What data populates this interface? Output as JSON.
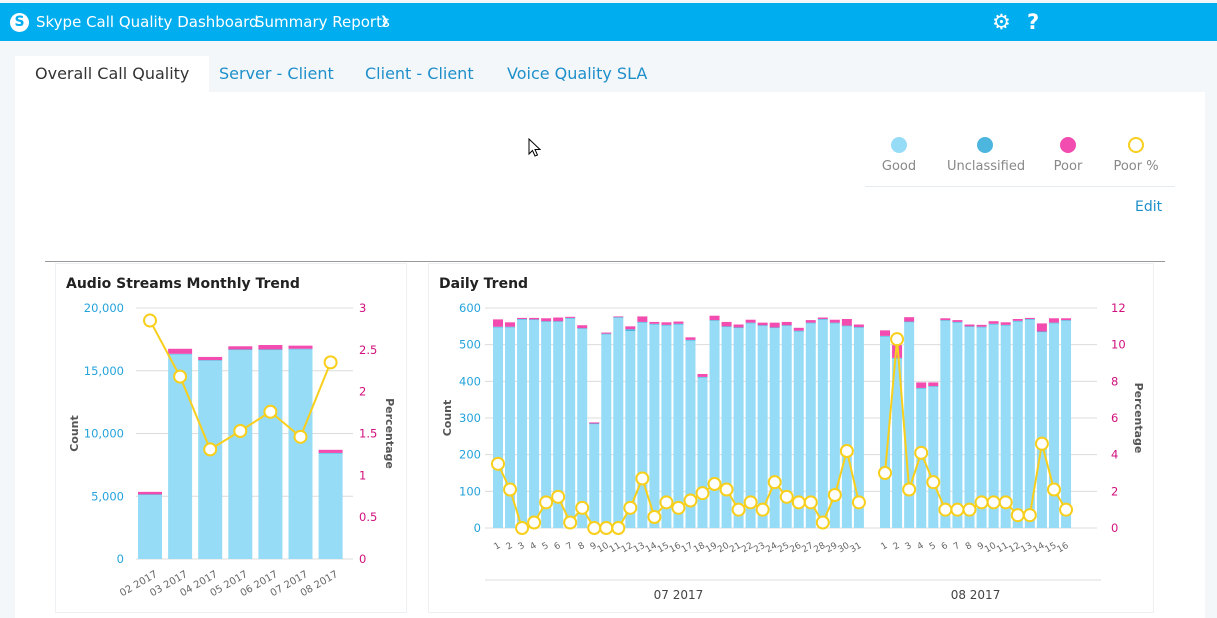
{
  "header": {
    "logo_letter": "S",
    "app_title": "Skype Call Quality Dashboard",
    "menu_label": "Summary Reports",
    "menu_chevron": "⌄",
    "settings_icon": "⚙",
    "help_icon": "?"
  },
  "tabs": [
    {
      "label": "Overall Call Quality",
      "active": true
    },
    {
      "label": "Server - Client",
      "active": false
    },
    {
      "label": "Client - Client",
      "active": false
    },
    {
      "label": "Voice Quality SLA",
      "active": false
    }
  ],
  "legend": [
    {
      "label": "Good",
      "color": "#96dcf6",
      "style": "filled"
    },
    {
      "label": "Unclassified",
      "color": "#4cb6de",
      "style": "filled"
    },
    {
      "label": "Poor",
      "color": "#f24cb0",
      "style": "filled"
    },
    {
      "label": "Poor %",
      "color": "#f8cf1c",
      "style": "ring"
    }
  ],
  "edit_label": "Edit",
  "colors": {
    "accent": "#00adef",
    "good": "#96dcf6",
    "unclassified": "#4cb6de",
    "poor": "#f24cb0",
    "poor_pct": "#f8cf1c",
    "left_axis": "#25a3dc",
    "right_axis": "#d1107e"
  },
  "chart_data": [
    {
      "type": "bar",
      "title": "Audio Streams Monthly Trend",
      "stacked": true,
      "categories": [
        "02 2017",
        "03 2017",
        "04 2017",
        "05 2017",
        "06 2017",
        "07 2017",
        "08 2017"
      ],
      "series": [
        {
          "name": "Good",
          "values": [
            5100,
            16300,
            15800,
            16650,
            16650,
            16700,
            8400
          ]
        },
        {
          "name": "Unclassified",
          "values": [
            50,
            50,
            50,
            50,
            50,
            50,
            50
          ]
        },
        {
          "name": "Poor",
          "values": [
            200,
            400,
            250,
            250,
            350,
            250,
            250
          ]
        },
        {
          "name": "Poor %",
          "type": "line",
          "axis": "right",
          "values": [
            2.85,
            2.18,
            1.31,
            1.53,
            1.76,
            1.46,
            2.35
          ]
        }
      ],
      "ylabel": "Count",
      "ylabel_right": "Percentage",
      "ylim": [
        0,
        20000
      ],
      "yticks": [
        "0",
        "5,000",
        "10,000",
        "15,000",
        "20,000"
      ],
      "ylim_right": [
        0,
        3
      ],
      "yticks_right": [
        "0",
        "0.5",
        "1",
        "1.5",
        "2",
        "2.5",
        "3"
      ],
      "grid": true
    },
    {
      "type": "bar",
      "title": "Daily Trend",
      "stacked": true,
      "groups": [
        {
          "label": "07 2017",
          "days": [
            "1",
            "2",
            "3",
            "4",
            "5",
            "6",
            "7",
            "8",
            "9",
            "10",
            "11",
            "12",
            "13",
            "14",
            "15",
            "16",
            "17",
            "18",
            "19",
            "20",
            "21",
            "22",
            "23",
            "24",
            "25",
            "26",
            "27",
            "28",
            "29",
            "30",
            "31"
          ]
        },
        {
          "label": "08 2017",
          "days": [
            "1",
            "2",
            "3",
            "4",
            "5",
            "6",
            "7",
            "8",
            "9",
            "10",
            "11",
            "12",
            "13",
            "14",
            "15",
            "16"
          ]
        }
      ],
      "series": [
        {
          "name": "Good",
          "values": [
            547,
            547,
            568,
            567,
            562,
            562,
            571,
            543,
            283,
            528,
            573,
            537,
            560,
            555,
            552,
            555,
            511,
            410,
            565,
            548,
            545,
            558,
            551,
            545,
            551,
            536,
            558,
            568,
            558,
            550,
            546,
            522,
            462,
            561,
            380,
            385,
            565,
            560,
            548,
            547,
            555,
            552,
            563,
            568,
            534,
            558,
            565
          ]
        },
        {
          "name": "Unclassified",
          "values": [
            2,
            2,
            2,
            2,
            2,
            2,
            2,
            2,
            2,
            2,
            2,
            5,
            2,
            2,
            2,
            2,
            2,
            2,
            2,
            2,
            2,
            2,
            2,
            2,
            2,
            2,
            2,
            2,
            2,
            2,
            2,
            2,
            2,
            2,
            2,
            2,
            2,
            2,
            2,
            2,
            2,
            2,
            2,
            2,
            2,
            2,
            2
          ]
        },
        {
          "name": "Poor",
          "values": [
            20,
            12,
            3,
            4,
            8,
            10,
            3,
            8,
            3,
            3,
            2,
            8,
            15,
            5,
            7,
            6,
            7,
            8,
            12,
            12,
            8,
            8,
            7,
            13,
            9,
            8,
            7,
            4,
            8,
            18,
            7,
            15,
            35,
            12,
            15,
            10,
            5,
            5,
            5,
            5,
            7,
            7,
            5,
            3,
            22,
            12,
            5
          ]
        },
        {
          "name": "Poor %",
          "type": "line",
          "axis": "right",
          "values": [
            3.5,
            2.1,
            0,
            0.3,
            1.4,
            1.7,
            0.3,
            1.1,
            0,
            0,
            0,
            1.1,
            2.7,
            0.6,
            1.4,
            1.1,
            1.5,
            1.9,
            2.4,
            2.1,
            1.0,
            1.4,
            1.0,
            2.5,
            1.7,
            1.4,
            1.4,
            0.3,
            1.8,
            4.2,
            1.4,
            3.0,
            10.3,
            2.1,
            4.1,
            2.5,
            1.0,
            1.0,
            1.0,
            1.4,
            1.4,
            1.4,
            0.7,
            0.7,
            4.6,
            2.1,
            1.0
          ]
        }
      ],
      "ylabel": "Count",
      "ylabel_right": "Percentage",
      "ylim": [
        0,
        600
      ],
      "yticks": [
        "0",
        "100",
        "200",
        "300",
        "400",
        "500",
        "600"
      ],
      "ylim_right": [
        0,
        12
      ],
      "yticks_right": [
        "0",
        "2",
        "4",
        "6",
        "8",
        "10",
        "12"
      ],
      "grid": true
    }
  ]
}
